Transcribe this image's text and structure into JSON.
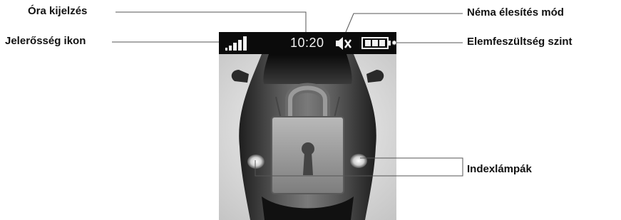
{
  "labels": {
    "clock": "Óra kijelzés",
    "signal": "Jelerősség ikon",
    "mute": "Néma élesítés mód",
    "battery": "Elemfeszültség szint",
    "indicator_lights": "Indexlámpák"
  },
  "status_bar": {
    "time": "10:20",
    "icons": [
      "signal-strength-icon",
      "mute-speaker-icon",
      "battery-icon"
    ],
    "signal_level": 1.0,
    "battery_level": 1.0,
    "muted": true
  },
  "screen": {
    "image": "sports-car-top-view",
    "overlay_icon": "padlock-locked-icon"
  },
  "colors": {
    "status_bar_bg": "#0b0b0b",
    "status_text": "#f2f2f2",
    "leader_line": "#555555",
    "label_text": "#111111"
  }
}
